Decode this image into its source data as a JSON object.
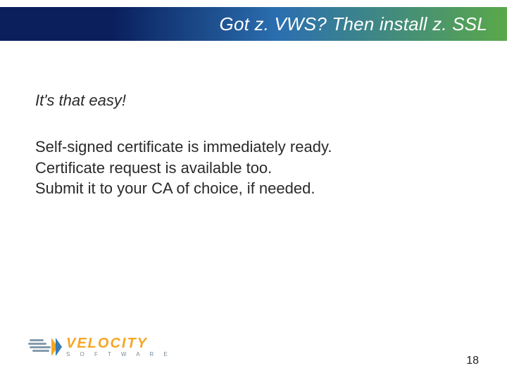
{
  "header": {
    "title": "Got z. VWS? Then install z. SSL"
  },
  "content": {
    "lead": "It's that easy!",
    "lines": [
      "Self-signed certificate is immediately ready.",
      "Certificate request is available too.",
      "Submit it to your CA of choice, if needed."
    ]
  },
  "footer": {
    "brand": "VELOCITY",
    "tagline": "S  O  F  T  W  A  R  E",
    "page_number": "18"
  }
}
